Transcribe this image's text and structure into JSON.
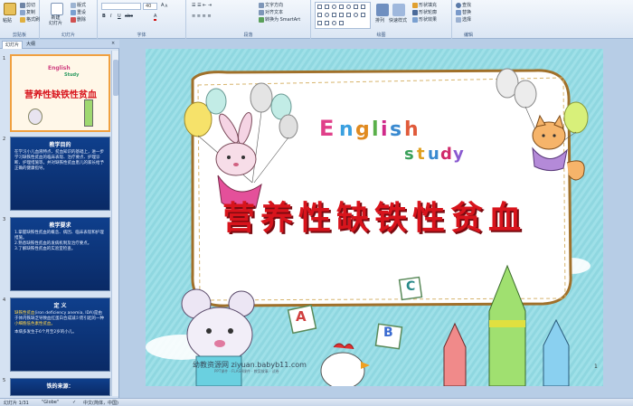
{
  "ribbon": {
    "groups": {
      "clipboard": "剪贴板",
      "slides": "幻灯片",
      "font": "字体",
      "paragraph": "段落",
      "drawing": "绘图",
      "editing": "编辑"
    },
    "clipboard": {
      "paste": "粘贴",
      "cut": "剪切",
      "copy": "复制",
      "format_painter": "格式刷"
    },
    "slides": {
      "new_slide": "新建",
      "new_slide2": "幻灯片",
      "layout": "版式",
      "reset": "重设",
      "delete": "删除"
    },
    "font": {
      "size": "40"
    },
    "paragraph": {
      "text_direction": "文字方向",
      "align_text": "对齐文本",
      "smartart": "转换为 SmartArt"
    },
    "drawing": {
      "arrange": "排列",
      "quick_styles": "快速样式",
      "shape_fill": "形状填充",
      "shape_outline": "形状轮廓",
      "shape_effects": "形状效果"
    },
    "editing": {
      "find": "查找",
      "replace": "替换",
      "select": "选择"
    }
  },
  "panel": {
    "tab_slides": "幻灯片",
    "tab_outline": "大纲"
  },
  "thumbs": [
    {
      "num": "1",
      "title": "营养性缺铁性贫血",
      "eng1": "English",
      "eng2": "Study"
    },
    {
      "num": "2",
      "title": "教学目的",
      "text": "在学习小儿血液特点、贫血知识的基础上，进一步学习缺铁性贫血的临床表现、治疗要点、护理诊断、护理措施等，并对缺铁性贫血患儿的家长给予正确的健康指导。"
    },
    {
      "num": "3",
      "title": "教学要求",
      "l1": "1.掌握缺铁性贫血的概念、病因、临床表现和护理措施。",
      "l2": "2.熟悉缺铁性贫血的发病机制及治疗要点。",
      "l3": "3.了解缺铁性贫血的实验室检查。"
    },
    {
      "num": "4",
      "title": "定  义",
      "l1": "缺铁性贫血",
      "l1b": "(iron deficiency anemia, IDA)是由于体内铁缺乏导致血红蛋白合成减少而引起的一种",
      "l1c": "小细胞低色素性贫血。",
      "l2": "本病多发生于6个月至2岁的小儿。"
    },
    {
      "num": "5",
      "title": "铁的来源："
    }
  ],
  "slide": {
    "title": "营养性缺铁性贫血",
    "english": "English",
    "study": "study",
    "letter_a": "A",
    "letter_b": "B",
    "letter_c": "C",
    "watermark": "幼教资源网 ziyuan.babyb11.com",
    "watermark_sub": "PPT课件 · FLASH课件 · 教案故事 · 试卷",
    "page_number": "1"
  },
  "status": {
    "slide_count": "幻灯片 1/31",
    "theme": "\"Globe\"",
    "language": "中文(简体，中国)"
  },
  "colors": {
    "title_red": "#d8141c",
    "slide_bg": "#8fd7e0",
    "thumb_blue": "#0f3f8c"
  }
}
